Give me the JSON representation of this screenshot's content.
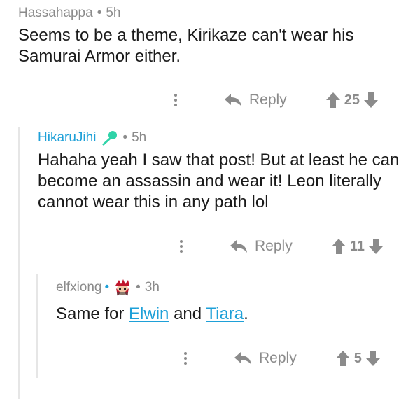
{
  "comments": [
    {
      "author": "Hassahappa",
      "separator": "•",
      "time": "5h",
      "text": "Seems to be a theme, Kirikaze can't wear his Samurai Armor either.",
      "reply_label": "Reply",
      "votes": "25"
    },
    {
      "author": "HikaruJihi",
      "separator": "•",
      "time": "5h",
      "badge_icon": "microphone-icon",
      "text": "Hahaha yeah I saw that post! But at least he can become an assassin and wear it! Leon literally cannot wear this in any path lol",
      "reply_label": "Reply",
      "votes": "11"
    },
    {
      "author": "elfxiong",
      "separator": "•",
      "separator2": "•",
      "time": "3h",
      "badge_icon": "avatar-icon",
      "text_prefix": "Same for ",
      "link1": "Elwin",
      "text_mid": " and ",
      "link2": "Tiara",
      "text_suffix": ".",
      "reply_label": "Reply",
      "votes": "5"
    }
  ],
  "colors": {
    "link": "#1ea0d8",
    "meta": "#8b8b8b",
    "text": "#1a1a1a",
    "thread_line": "#e6e6e6"
  }
}
